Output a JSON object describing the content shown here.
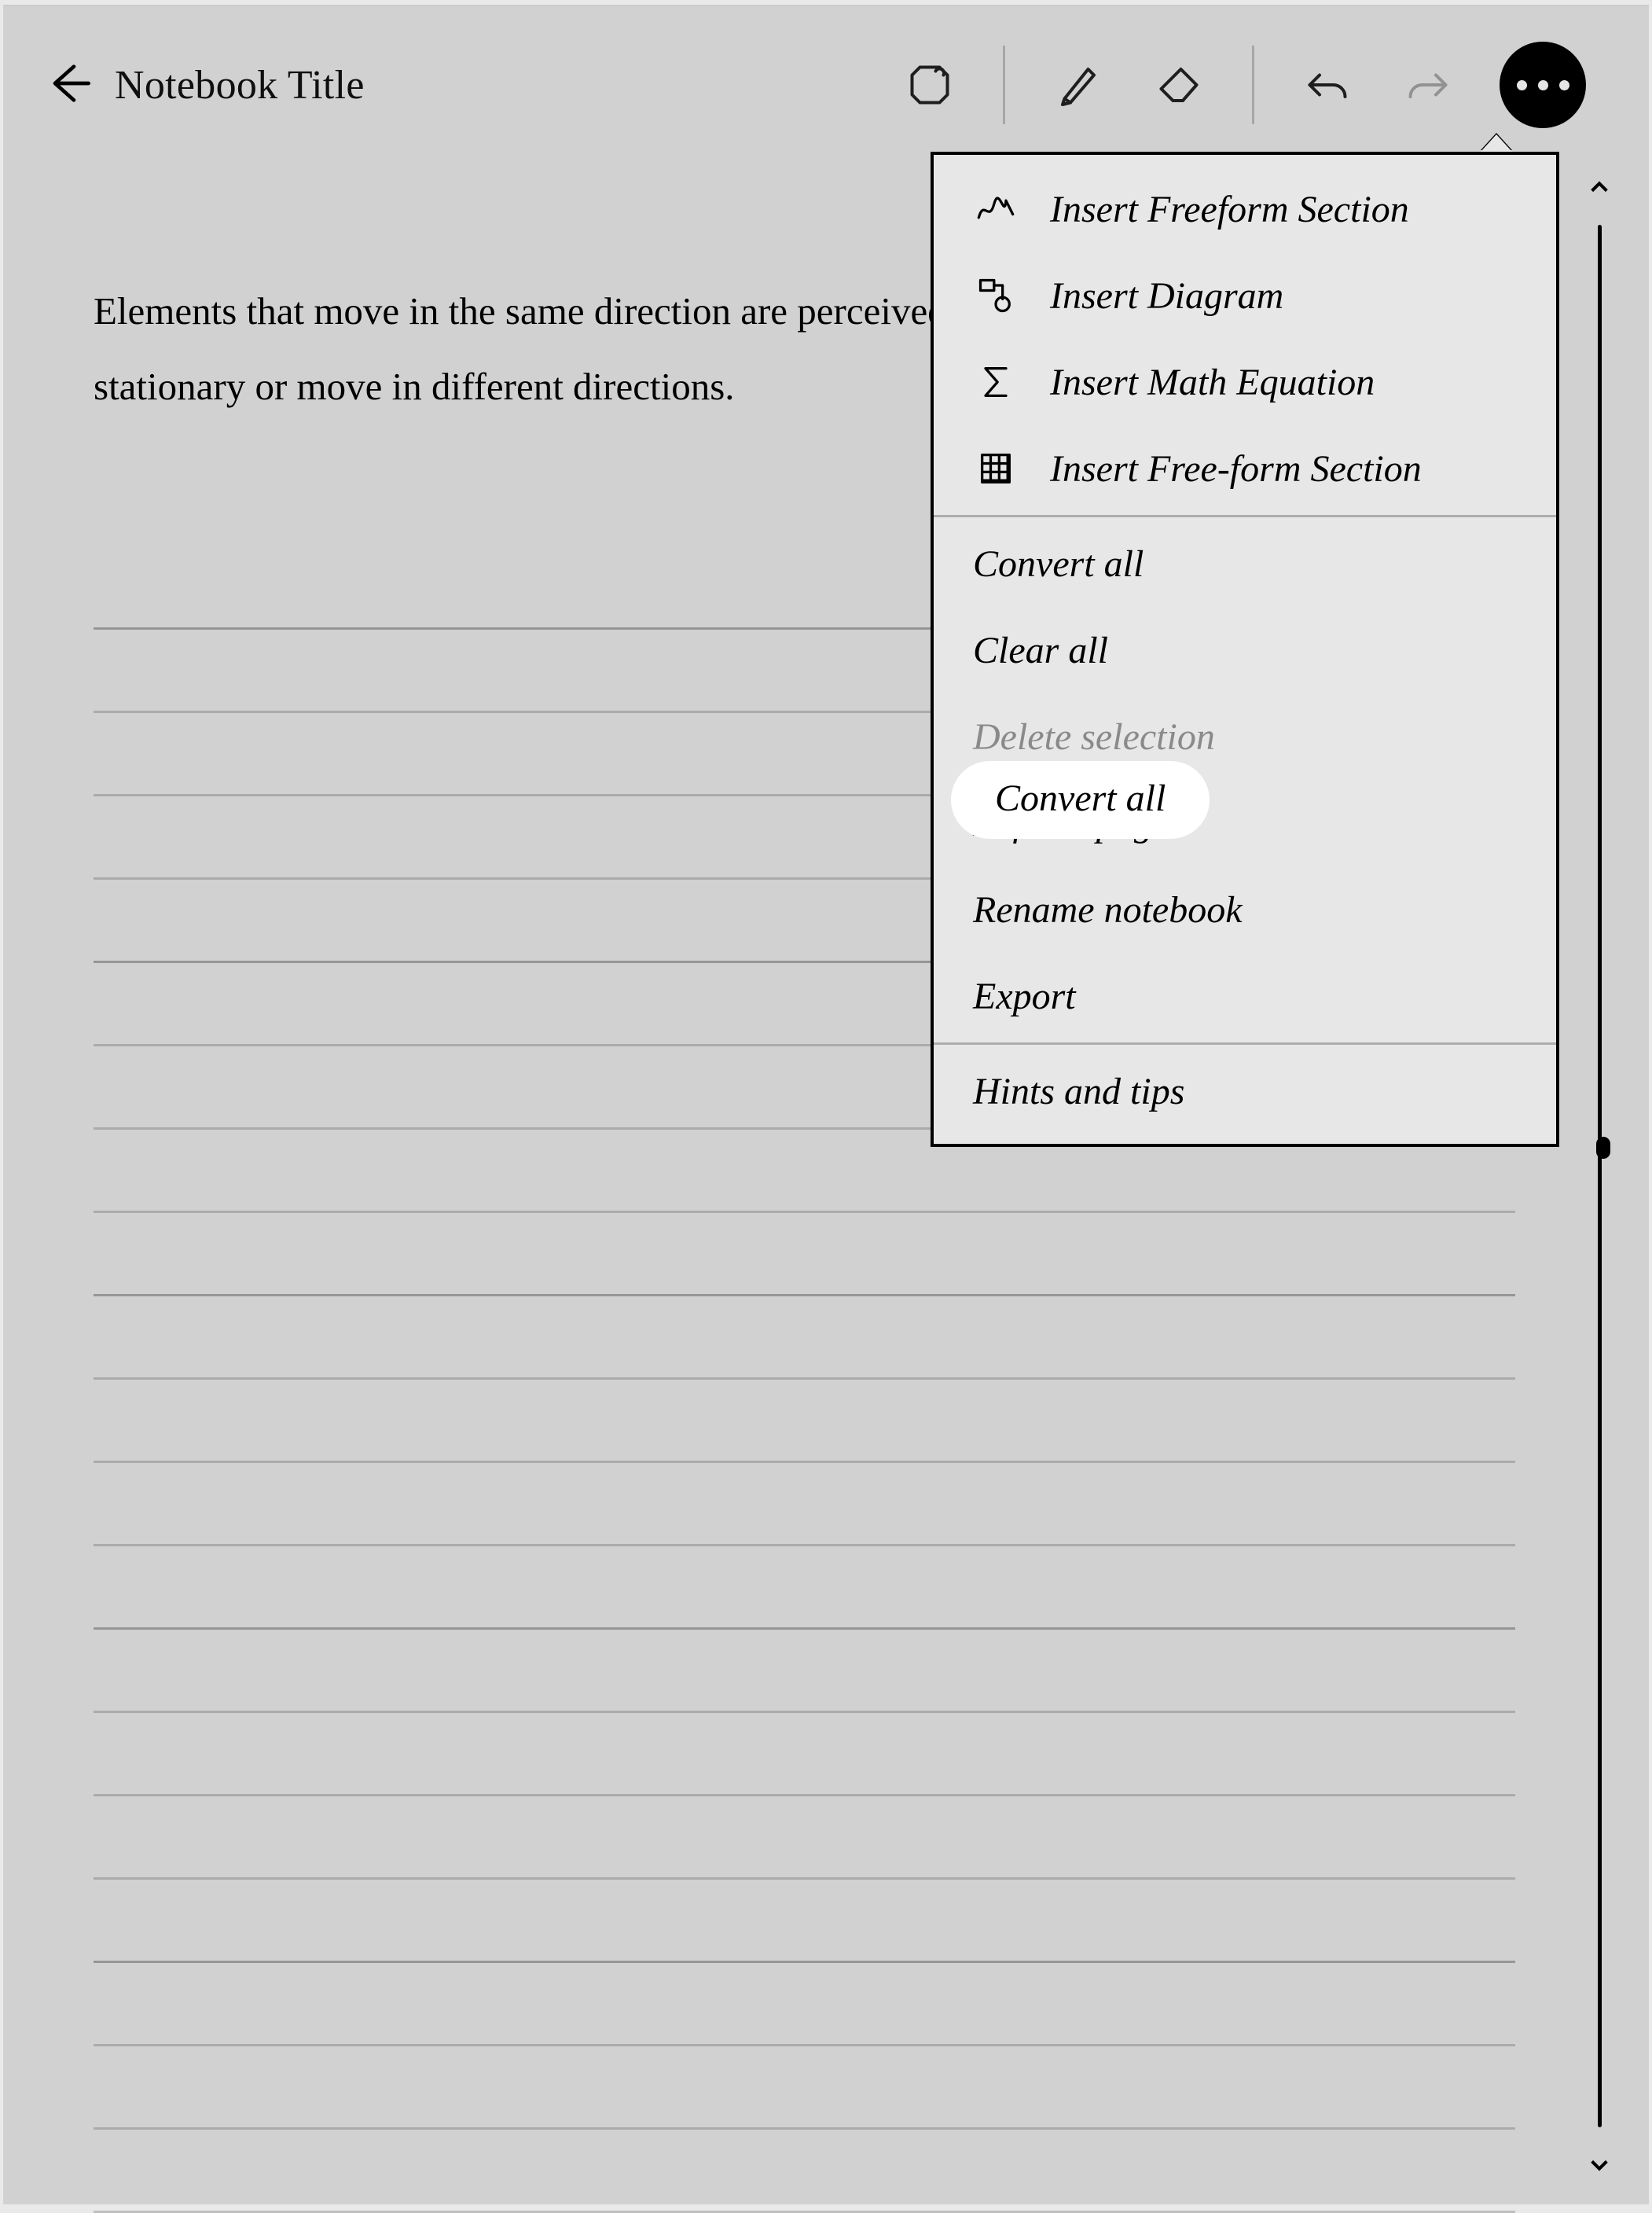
{
  "header": {
    "title": "Notebook Title"
  },
  "body": {
    "text": "Elements that move in the same direction are perceived as more related than those that are stationary or move in different directions."
  },
  "menu": {
    "insert": [
      {
        "icon": "scribble-icon",
        "label": "Insert Freeform Section"
      },
      {
        "icon": "diagram-icon",
        "label": "Insert Diagram"
      },
      {
        "icon": "sigma-icon",
        "label": "Insert Math Equation"
      },
      {
        "icon": "grid-icon",
        "label": "Insert Free-form Section"
      }
    ],
    "actions": {
      "convert_all": "Convert all",
      "clear_all": "Clear all",
      "delete_selection": "Delete selection",
      "refresh_page": "Refresh page",
      "rename_notebook": "Rename notebook",
      "export": "Export"
    },
    "footer": {
      "hints": "Hints and tips"
    },
    "highlighted": "Convert all"
  }
}
